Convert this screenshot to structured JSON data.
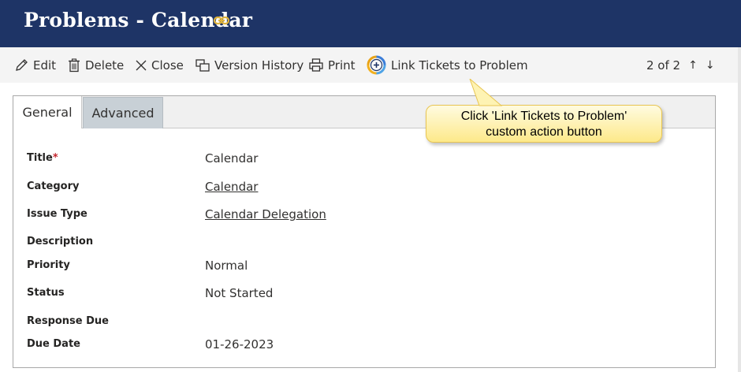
{
  "header": {
    "title": "Problems - Calendar"
  },
  "toolbar": {
    "edit": "Edit",
    "delete": "Delete",
    "close": "Close",
    "version_history": "Version History",
    "print": "Print",
    "link_tickets": "Link Tickets to Problem",
    "pager": "2 of 2"
  },
  "callout": {
    "line1": "Click 'Link Tickets to Problem'",
    "line2": "custom action button"
  },
  "tabs": {
    "general": "General",
    "advanced": "Advanced"
  },
  "fields": {
    "title_label": "Title",
    "title_required": "*",
    "title_value": "Calendar",
    "category_label": "Category",
    "category_value": "Calendar",
    "issue_type_label": "Issue Type",
    "issue_type_value": "Calendar Delegation",
    "description_label": "Description",
    "priority_label": "Priority",
    "priority_value": "Normal",
    "status_label": "Status",
    "status_value": "Not Started",
    "response_due_label": "Response Due",
    "due_date_label": "Due Date",
    "due_date_value": "01-26-2023"
  },
  "icons": {
    "link": "link-icon",
    "edit": "pencil-icon",
    "delete": "trash-icon",
    "close": "close-icon",
    "version_history": "version-history-icon",
    "print": "printer-icon",
    "link_tickets": "add-circle-icon",
    "up": "arrow-up-icon",
    "down": "arrow-down-icon"
  },
  "colors": {
    "header_bg": "#1e3466",
    "link_icon": "#e0b33a",
    "callout_bg": "#fde98a",
    "required": "#c4262e"
  }
}
